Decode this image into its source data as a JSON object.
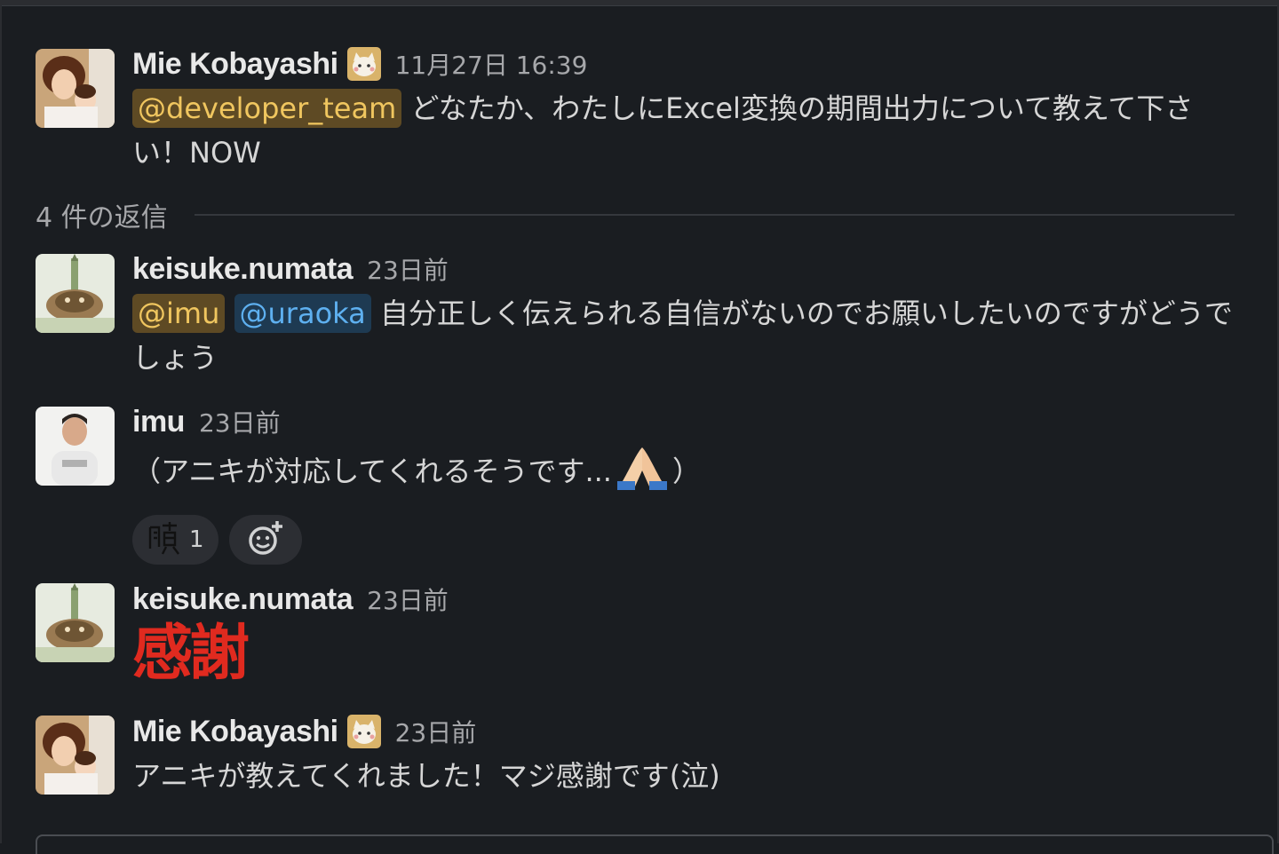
{
  "thread": {
    "parent": {
      "author": "Mie Kobayashi",
      "timestamp": "11月27日 16:39",
      "mention": "@developer_team",
      "text": "どなたか、わたしにExcel変換の期間出力について教えて下さい！NOW",
      "status_badge_icon": "cat-face-icon"
    },
    "reply_count_label": "4 件の返信",
    "replies": [
      {
        "author": "keisuke.numata",
        "timestamp": "23日前",
        "mentions": [
          "@imu",
          "@uraoka"
        ],
        "text": "自分正しく伝えられる自信がないのでお願いしたいのですがどうでしょう"
      },
      {
        "author": "imu",
        "timestamp": "23日前",
        "text_before_emoji": "（アニキが対応してくれるそうです...",
        "emoji": "folded-hands-emoji",
        "text_after_emoji": "）",
        "reactions": [
          {
            "emoji": "kanji-stamp-emoji",
            "count": "1"
          }
        ],
        "add_reaction_icon": "add-reaction-icon"
      },
      {
        "author": "keisuke.numata",
        "timestamp": "23日前",
        "text": "感謝"
      },
      {
        "author": "Mie Kobayashi",
        "timestamp": "23日前",
        "text": "アニキが教えてくれました！マジ感謝です(泣)",
        "status_badge_icon": "cat-face-icon"
      }
    ]
  },
  "colors": {
    "background": "#1a1d21",
    "mention_highlight_bg": "#5e4a24",
    "mention_highlight_text": "#f0c65f",
    "mention_user_bg": "#1e3a52",
    "mention_user_text": "#5eb0f0",
    "big_text": "#e02a1f"
  }
}
